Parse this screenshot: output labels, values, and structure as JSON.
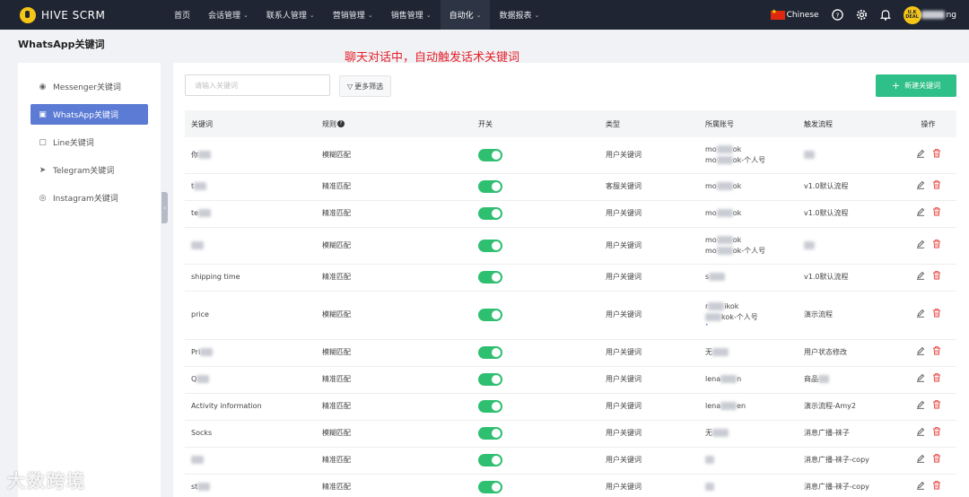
{
  "app": {
    "name": "HIVE SCRM"
  },
  "nav": [
    {
      "label": "首页",
      "active": false
    },
    {
      "label": "会话管理",
      "active": false
    },
    {
      "label": "联系人管理",
      "active": false
    },
    {
      "label": "营销管理",
      "active": false
    },
    {
      "label": "销售管理",
      "active": false
    },
    {
      "label": "自动化",
      "active": true
    },
    {
      "label": "数据报表",
      "active": false
    }
  ],
  "topRight": {
    "language": "Chinese",
    "username_suffix": "ng",
    "avatar_text": "U.K DEAL"
  },
  "page": {
    "title": "WhatsApp关键词"
  },
  "annotation": "聊天对话中，自动触发话术关键词",
  "sidebar": {
    "items": [
      {
        "label": "Messenger关键词",
        "icon": "messenger-icon",
        "active": false
      },
      {
        "label": "WhatsApp关键词",
        "icon": "whatsapp-icon",
        "active": true
      },
      {
        "label": "Line关键词",
        "icon": "line-icon",
        "active": false
      },
      {
        "label": "Telegram关键词",
        "icon": "telegram-icon",
        "active": false
      },
      {
        "label": "Instagram关键词",
        "icon": "instagram-icon",
        "active": false
      }
    ]
  },
  "toolbar": {
    "search_placeholder": "请输入关键词",
    "filter_label": "更多筛选",
    "new_label": "新建关键词"
  },
  "table": {
    "headers": {
      "keyword": "关键词",
      "rule": "规则",
      "switch": "开关",
      "type": "类型",
      "account": "所属账号",
      "flow": "触发流程",
      "ops": "操作"
    },
    "rows": [
      {
        "keyword": "你",
        "rule": "模糊匹配",
        "enabled": true,
        "type": "用户关键词",
        "account": [
          "mo",
          "ok",
          "mo",
          "ok-个人号"
        ],
        "flow": ""
      },
      {
        "keyword": "t",
        "rule": "精准匹配",
        "enabled": true,
        "type": "客服关键词",
        "account": [
          "mo",
          "ok"
        ],
        "flow": "v1.0默认流程"
      },
      {
        "keyword": "te",
        "rule": "精准匹配",
        "enabled": true,
        "type": "用户关键词",
        "account": [
          "mo",
          "ok"
        ],
        "flow": "v1.0默认流程"
      },
      {
        "keyword": "",
        "rule": "模糊匹配",
        "enabled": true,
        "type": "用户关键词",
        "account": [
          "mo",
          "ok",
          "mo",
          "ok-个人号"
        ],
        "flow": ""
      },
      {
        "keyword": "shipping time",
        "rule": "精准匹配",
        "enabled": true,
        "type": "用户关键词",
        "account": [
          "s",
          ""
        ],
        "flow": "v1.0默认流程"
      },
      {
        "keyword": "price",
        "rule": "模糊匹配",
        "enabled": true,
        "type": "用户关键词",
        "account": [
          "r",
          "ikok",
          "",
          "kok-个人号"
        ],
        "flow": "演示流程"
      },
      {
        "keyword": "Pri",
        "rule": "模糊匹配",
        "enabled": true,
        "type": "用户关键词",
        "account": [
          "无",
          ""
        ],
        "flow": "用户状态修改"
      },
      {
        "keyword": "Q",
        "rule": "精准匹配",
        "enabled": true,
        "type": "用户关键词",
        "account": [
          "lena",
          "n"
        ],
        "flow": "商品"
      },
      {
        "keyword": "Activity information",
        "rule": "精准匹配",
        "enabled": true,
        "type": "用户关键词",
        "account": [
          "lena",
          "en"
        ],
        "flow": "演示流程-Amy2"
      },
      {
        "keyword": "Socks",
        "rule": "模糊匹配",
        "enabled": true,
        "type": "用户关键词",
        "account": [
          "无",
          ""
        ],
        "flow": "消息广播-袜子"
      },
      {
        "keyword": "",
        "rule": "精准匹配",
        "enabled": true,
        "type": "用户关键词",
        "account": [
          "",
          ""
        ],
        "flow": "消息广播-袜子-copy"
      },
      {
        "keyword": "st",
        "rule": "精准匹配",
        "enabled": true,
        "type": "用户关键词",
        "account": [
          "",
          ""
        ],
        "flow": "消息广播-袜子-copy"
      }
    ]
  },
  "watermark": "大数跨境",
  "colors": {
    "topbar": "#1f2532",
    "active_side": "#5b7bd5",
    "primary_green": "#2fbf88",
    "toggle_on": "#2fbf71",
    "delete_red": "#e53935",
    "annotation_red": "#e6202a"
  }
}
